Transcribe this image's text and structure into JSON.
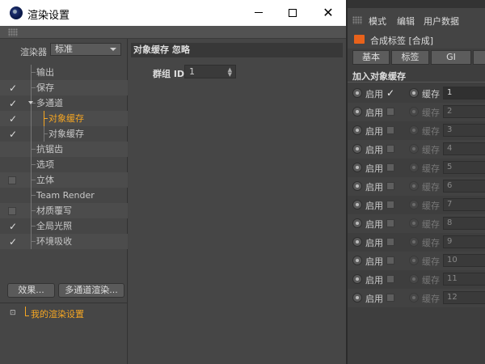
{
  "window": {
    "title": "渲染设置",
    "controls": {
      "minimize": "minimize",
      "maximize": "maximize",
      "close": "✕"
    }
  },
  "left_panel": {
    "renderer_label": "渲染器",
    "renderer_value": "标准",
    "tree": [
      {
        "label": "输出",
        "checked": null,
        "level": 1
      },
      {
        "label": "保存",
        "checked": true,
        "level": 1
      },
      {
        "label": "多通道",
        "checked": true,
        "level": 1,
        "expanded": true
      },
      {
        "label": "对象缓存",
        "checked": true,
        "level": 2,
        "active": true
      },
      {
        "label": "对象缓存",
        "checked": true,
        "level": 2
      },
      {
        "label": "抗锯齿",
        "checked": null,
        "level": 1
      },
      {
        "label": "选项",
        "checked": null,
        "level": 1
      },
      {
        "label": "立体",
        "checked": false,
        "level": 1
      },
      {
        "label": "Team Render",
        "checked": null,
        "level": 1
      },
      {
        "label": "材质覆写",
        "checked": false,
        "level": 1
      },
      {
        "label": "全局光照",
        "checked": true,
        "level": 1
      },
      {
        "label": "环境吸收",
        "checked": true,
        "level": 1
      }
    ],
    "effects_button": "效果...",
    "multipass_button": "多通道渲染...",
    "preset_label": "我的渲染设置"
  },
  "content": {
    "header": "对象缓存 忽略",
    "group_id_label": "群组 ID",
    "group_id_value": "1"
  },
  "attr": {
    "menu": {
      "mode": "模式",
      "edit": "编辑",
      "user_data": "用户数据"
    },
    "tag_title": "合成标签 [合成]",
    "tabs": {
      "basic": "基本",
      "tag": "标签",
      "gi": "GI",
      "more": ""
    },
    "section_title": "加入对象缓存",
    "enable_label": "启用",
    "cache_label": "缓存",
    "slots": [
      {
        "enabled": true,
        "cache": "1"
      },
      {
        "enabled": false,
        "cache": "2"
      },
      {
        "enabled": false,
        "cache": "3"
      },
      {
        "enabled": false,
        "cache": "4"
      },
      {
        "enabled": false,
        "cache": "5"
      },
      {
        "enabled": false,
        "cache": "6"
      },
      {
        "enabled": false,
        "cache": "7"
      },
      {
        "enabled": false,
        "cache": "8"
      },
      {
        "enabled": false,
        "cache": "9"
      },
      {
        "enabled": false,
        "cache": "10"
      },
      {
        "enabled": false,
        "cache": "11"
      },
      {
        "enabled": false,
        "cache": "12"
      }
    ]
  },
  "colors": {
    "accent_orange": "#f5a623",
    "panel": "#464646",
    "tag_icon": "#e8621b"
  }
}
